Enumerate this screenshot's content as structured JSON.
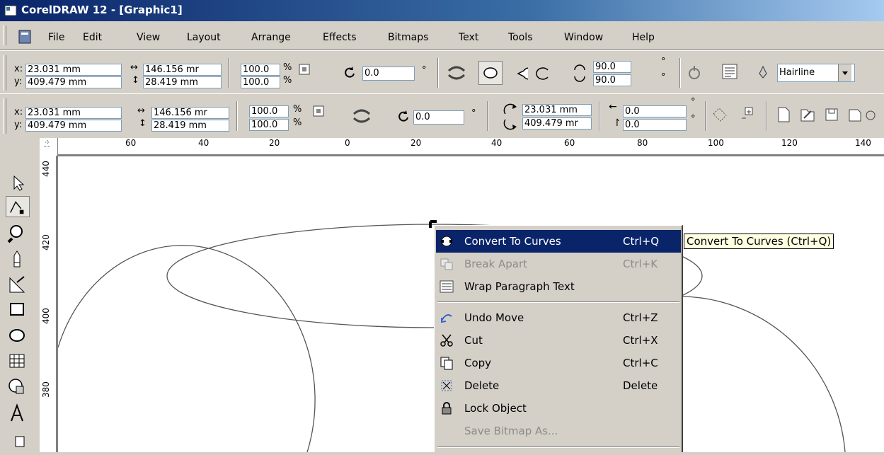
{
  "window": {
    "title": "CorelDRAW 12 - [Graphic1]"
  },
  "menu": [
    "File",
    "Edit",
    "View",
    "Layout",
    "Arrange",
    "Effects",
    "Bitmaps",
    "Text",
    "Tools",
    "Window",
    "Help"
  ],
  "propbar1": {
    "x_label": "x:",
    "x_value": "23.031 mm",
    "y_label": "y:",
    "y_value": "409.479 mm",
    "width_value": "146.156 mr",
    "height_value": "28.419 mm",
    "scale_x": "100.0",
    "scale_y": "100.0",
    "percent": "%",
    "rotation": "0.0",
    "degree": "°",
    "start_angle": "90.0",
    "end_angle": "90.0",
    "outline_width": "Hairline"
  },
  "propbar2": {
    "x_label": "x:",
    "x_value": "23.031 mm",
    "y_label": "y:",
    "y_value": "409.479 mm",
    "width_value": "146.156 mr",
    "height_value": "28.419 mm",
    "scale_x": "100.0",
    "scale_y": "100.0",
    "percent": "%",
    "rotation": "0.0",
    "degree": "°",
    "center_x": "23.031 mm",
    "center_y": "409.479 mr",
    "skew_h": "0.0",
    "skew_v": "0.0"
  },
  "hruler": {
    "ticks": [
      "60",
      "40",
      "20",
      "0",
      "20",
      "40",
      "60",
      "80",
      "100",
      "120",
      "140"
    ]
  },
  "vruler": {
    "ticks": [
      "440",
      "420",
      "400",
      "380"
    ]
  },
  "context_menu": {
    "items": [
      {
        "label": "Convert To Curves",
        "shortcut": "Ctrl+Q",
        "icon": "convert-curves-icon",
        "state": "selected"
      },
      {
        "label": "Break Apart",
        "shortcut": "Ctrl+K",
        "icon": "break-apart-icon",
        "state": "disabled"
      },
      {
        "label": "Wrap Paragraph Text",
        "shortcut": "",
        "icon": "wrap-text-icon",
        "state": "normal"
      },
      {
        "label": "Undo Move",
        "shortcut": "Ctrl+Z",
        "icon": "undo-icon",
        "state": "normal"
      },
      {
        "label": "Cut",
        "shortcut": "Ctrl+X",
        "icon": "scissors-icon",
        "state": "normal"
      },
      {
        "label": "Copy",
        "shortcut": "Ctrl+C",
        "icon": "copy-icon",
        "state": "normal"
      },
      {
        "label": "Delete",
        "shortcut": "Delete",
        "icon": "delete-icon",
        "state": "normal"
      },
      {
        "label": "Lock Object",
        "shortcut": "",
        "icon": "lock-icon",
        "state": "normal"
      },
      {
        "label": "Save Bitmap As...",
        "shortcut": "",
        "icon": "",
        "state": "disabled"
      }
    ]
  },
  "tooltip": "Convert To Curves (Ctrl+Q)",
  "colors": {
    "title_start": "#0a246a",
    "title_end": "#a6caf0",
    "selection": "#0a246a",
    "face": "#d4d0c8",
    "tooltip_bg": "#ffffe1"
  }
}
